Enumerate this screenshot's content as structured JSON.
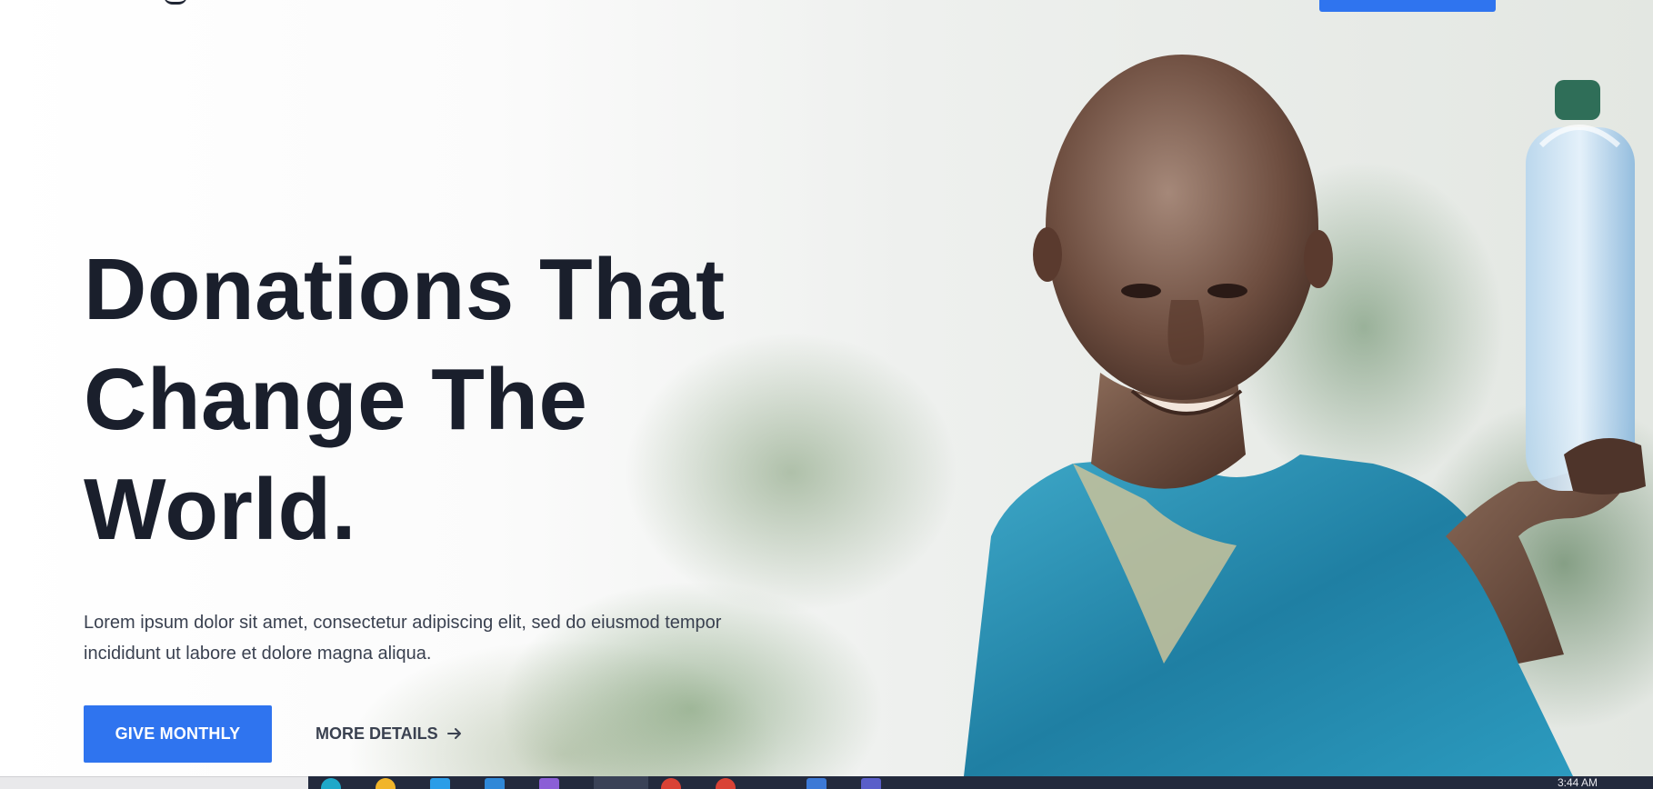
{
  "hero": {
    "headline_lines": [
      "Donations That",
      "Change The",
      "World."
    ],
    "lead_lines": [
      "Lorem ipsum dolor sit amet, consectetur adipiscing elit, sed do eiusmod tempor",
      "incididunt ut labore et dolore magna aliqua."
    ],
    "primary_button": "GIVE MONTHLY",
    "secondary_link": "MORE DETAILS",
    "secondary_icon": "arrow-right-icon",
    "image": "child-holding-water-bottle"
  },
  "nav": {
    "cta_color": "#2f74ef"
  },
  "taskbar": {
    "clock": "3:44 AM",
    "icons": [
      "chrome-icon",
      "folder-icon",
      "store-icon",
      "vscode-icon",
      "visual-studio-icon",
      "browser-icon",
      "chrome-icon",
      "chrome-icon",
      "chrome-icon",
      "file-icon",
      "mail-icon",
      "app-icon"
    ]
  },
  "colors": {
    "accent": "#2f74ef",
    "headline": "#1a1f2c",
    "body_text": "#3a4150",
    "taskbar": "#232a3d"
  }
}
